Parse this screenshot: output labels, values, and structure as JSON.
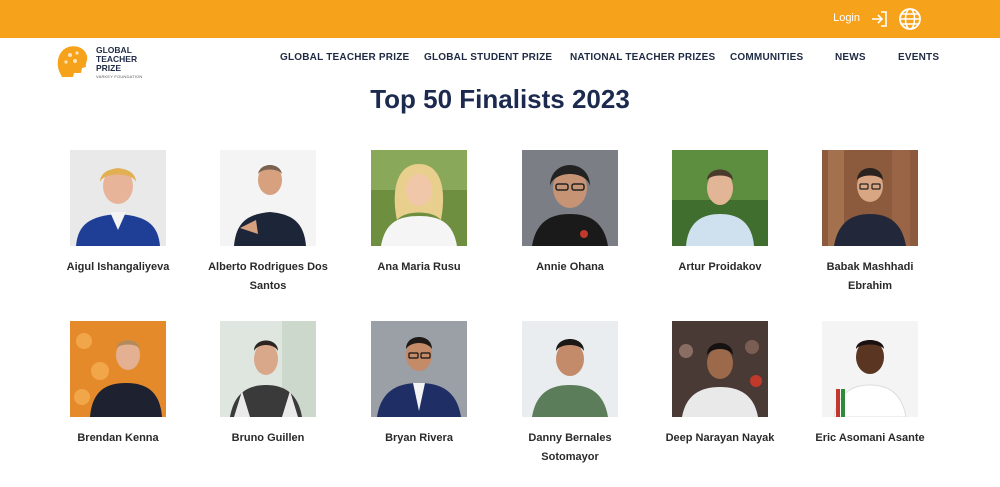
{
  "header": {
    "login_label": "Login",
    "login_icon": "login-icon",
    "language_icon": "globe-icon",
    "bar_color": "#f7a21b"
  },
  "logo": {
    "line1": "GLOBAL",
    "line2": "TEACHER",
    "line3": "PRIZE",
    "sub": "VARKEY FOUNDATION",
    "accent": "#f7a21b"
  },
  "nav": {
    "items": [
      {
        "label": "GLOBAL TEACHER PRIZE"
      },
      {
        "label": "GLOBAL STUDENT PRIZE"
      },
      {
        "label": "NATIONAL TEACHER PRIZES"
      },
      {
        "label": "COMMUNITIES"
      },
      {
        "label": "NEWS"
      },
      {
        "label": "EVENTS"
      }
    ]
  },
  "main": {
    "title": "Top 50 Finalists 2023",
    "finalists": [
      {
        "name_line1": "Aigul Ishangaliyeva",
        "name_line2": ""
      },
      {
        "name_line1": "Alberto Rodrigues Dos",
        "name_line2": "Santos"
      },
      {
        "name_line1": "Ana Maria Rusu",
        "name_line2": ""
      },
      {
        "name_line1": "Annie Ohana",
        "name_line2": ""
      },
      {
        "name_line1": "Artur Proidakov",
        "name_line2": ""
      },
      {
        "name_line1": "Babak Mashhadi",
        "name_line2": "Ebrahim"
      },
      {
        "name_line1": "Brendan Kenna",
        "name_line2": ""
      },
      {
        "name_line1": "Bruno Guillen",
        "name_line2": ""
      },
      {
        "name_line1": "Bryan Rivera",
        "name_line2": ""
      },
      {
        "name_line1": "Danny Bernales",
        "name_line2": "Sotomayor"
      },
      {
        "name_line1": "Deep Narayan Nayak",
        "name_line2": ""
      },
      {
        "name_line1": "Eric Asomani Asante",
        "name_line2": ""
      }
    ]
  }
}
